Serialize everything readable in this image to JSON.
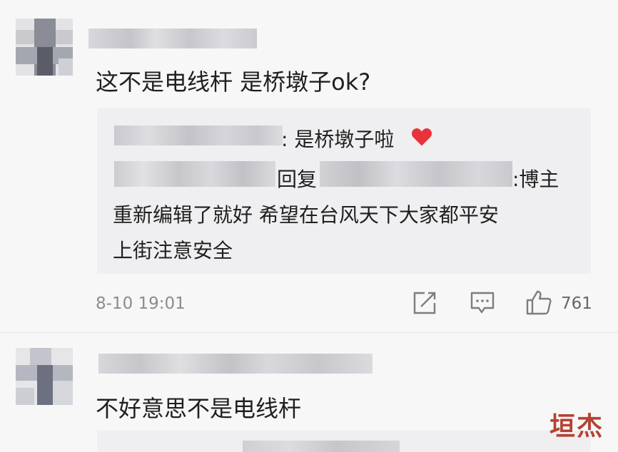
{
  "comment1": {
    "text": "这不是电线杆 是桥墩子ok?",
    "replies": [
      {
        "text": ": 是桥墩子啦"
      },
      {
        "reply_word": "回复",
        "text": ":博主",
        "text2": "重新编辑了就好 希望在台风天下大家都平安",
        "text3": "上街注意安全"
      }
    ],
    "time": "8-10 19:01",
    "likes": "761"
  },
  "comment2": {
    "text": "不好意思不是电线杆"
  },
  "watermark": "垣杰",
  "colors": {
    "heart": "#e8323c",
    "text": "#1f1f1f",
    "meta": "#8c8c8c"
  }
}
